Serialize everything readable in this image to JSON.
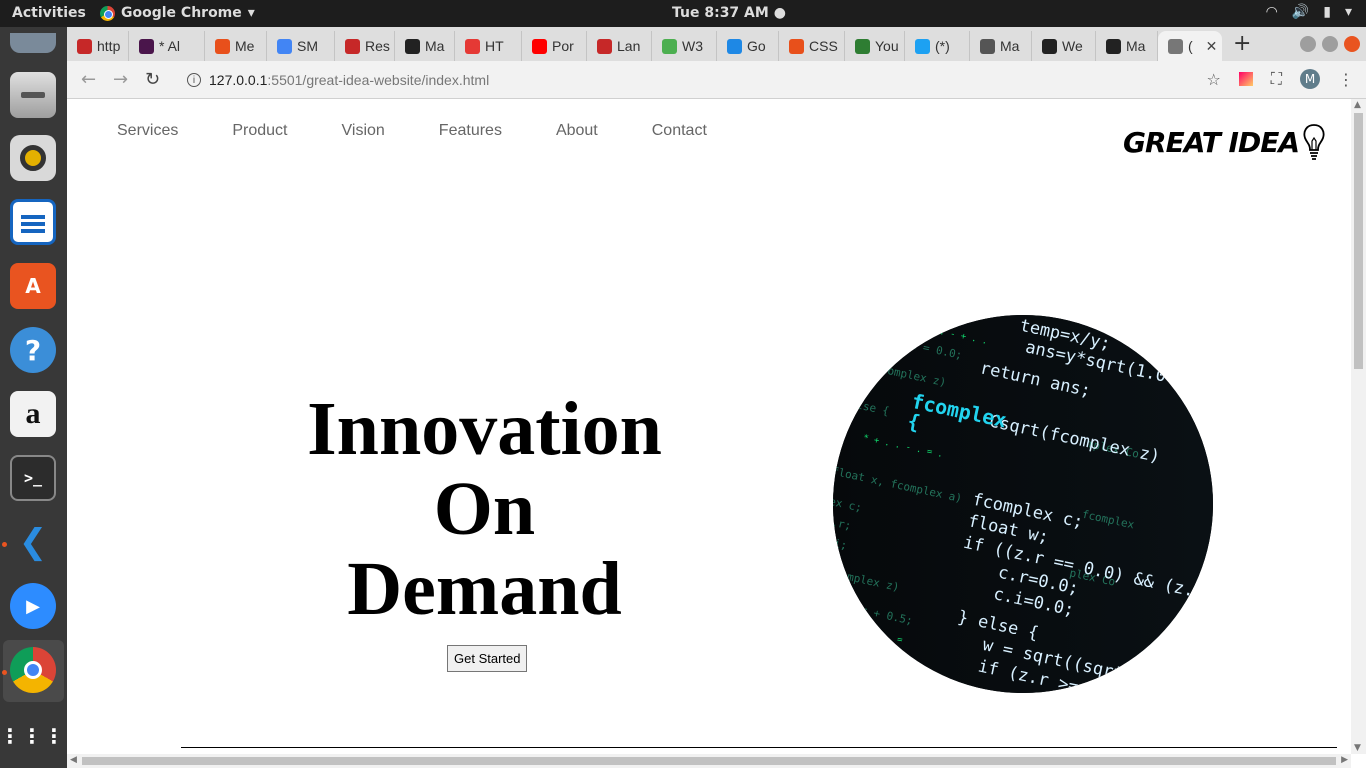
{
  "topbar": {
    "activities": "Activities",
    "app_name": "Google Chrome",
    "clock": "Tue  8:37 AM"
  },
  "dock": {
    "items": [
      "files-app",
      "disk-app",
      "rhythmbox-app",
      "writer-app",
      "software-center-app",
      "help-app",
      "amazon-app",
      "terminal-app",
      "vscode-app",
      "zoom-app",
      "chrome-app",
      "app-grid"
    ]
  },
  "tabs": [
    {
      "label": "http",
      "color": "#c62828"
    },
    {
      "label": "* Al",
      "color": "#4a154b"
    },
    {
      "label": "Me",
      "color": "#e8501b"
    },
    {
      "label": "SM",
      "color": "#4285f4"
    },
    {
      "label": "Res",
      "color": "#c62828"
    },
    {
      "label": "Ma",
      "color": "#222222"
    },
    {
      "label": "HT",
      "color": "#e53935"
    },
    {
      "label": "Por",
      "color": "#ff0000"
    },
    {
      "label": "Lan",
      "color": "#c62828"
    },
    {
      "label": "W3",
      "color": "#4caf50"
    },
    {
      "label": "Go",
      "color": "#1e88e5"
    },
    {
      "label": "CSS",
      "color": "#e8501b"
    },
    {
      "label": "You",
      "color": "#2e7d32"
    },
    {
      "label": "(*) ",
      "color": "#1da1f2"
    },
    {
      "label": "Ma",
      "color": "#555555"
    },
    {
      "label": "We",
      "color": "#222222"
    },
    {
      "label": "Ma",
      "color": "#222222"
    },
    {
      "label": "(",
      "color": "#777777",
      "active": true
    }
  ],
  "address": {
    "host": "127.0.0.1",
    "path": ":5501/great-idea-website/index.html",
    "avatar_letter": "M"
  },
  "site": {
    "nav": [
      "Services",
      "Product",
      "Vision",
      "Features",
      "About",
      "Contact"
    ],
    "logo": "GREAT IDEA",
    "hero_lines": [
      "Innovation",
      "On",
      "Demand"
    ],
    "cta": "Get Started"
  }
}
